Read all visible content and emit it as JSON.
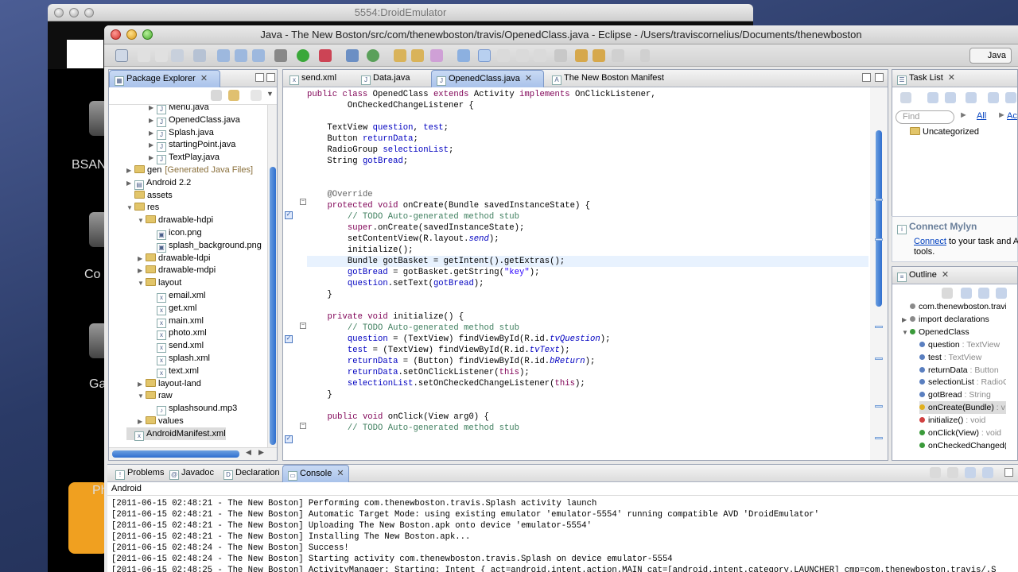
{
  "emulator": {
    "title": "5554:DroidEmulator",
    "labels": [
      "BSAN",
      "Co",
      "Ga",
      "Ph"
    ]
  },
  "eclipse": {
    "title": "Java - The New Boston/src/com/thenewboston/travis/OpenedClass.java - Eclipse - /Users/traviscornelius/Documents/thenewboston",
    "perspective": "Java"
  },
  "package_explorer": {
    "tab_label": "Package Explorer",
    "items": [
      {
        "label": "Menu.java",
        "icon": "java-file-icon",
        "level": 3,
        "top": 0
      },
      {
        "label": "OpenedClass.java",
        "icon": "java-file-icon",
        "level": 3
      },
      {
        "label": "Splash.java",
        "icon": "java-file-icon",
        "level": 3
      },
      {
        "label": "startingPoint.java",
        "icon": "java-file-icon",
        "level": 3
      },
      {
        "label": "TextPlay.java",
        "icon": "java-file-icon",
        "level": 3
      },
      {
        "label": "gen",
        "extra": "[Generated Java Files]",
        "icon": "folder-icon",
        "level": 1
      },
      {
        "label": "Android 2.2",
        "icon": "library-icon",
        "level": 1
      },
      {
        "label": "assets",
        "icon": "folder-icon",
        "level": 1
      },
      {
        "label": "res",
        "icon": "folder-icon",
        "level": 1
      },
      {
        "label": "drawable-hdpi",
        "icon": "folder-icon",
        "level": 2
      },
      {
        "label": "icon.png",
        "icon": "image-file-icon",
        "level": 3
      },
      {
        "label": "splash_background.png",
        "icon": "image-file-icon",
        "level": 3
      },
      {
        "label": "drawable-ldpi",
        "icon": "folder-icon",
        "level": 2
      },
      {
        "label": "drawable-mdpi",
        "icon": "folder-icon",
        "level": 2
      },
      {
        "label": "layout",
        "icon": "folder-icon",
        "level": 2
      },
      {
        "label": "email.xml",
        "icon": "xml-file-icon",
        "level": 3
      },
      {
        "label": "get.xml",
        "icon": "xml-file-icon",
        "level": 3
      },
      {
        "label": "main.xml",
        "icon": "xml-file-icon",
        "level": 3
      },
      {
        "label": "photo.xml",
        "icon": "xml-file-icon",
        "level": 3
      },
      {
        "label": "send.xml",
        "icon": "xml-file-icon",
        "level": 3
      },
      {
        "label": "splash.xml",
        "icon": "xml-file-icon",
        "level": 3
      },
      {
        "label": "text.xml",
        "icon": "xml-file-icon",
        "level": 3
      },
      {
        "label": "layout-land",
        "icon": "folder-icon",
        "level": 2
      },
      {
        "label": "raw",
        "icon": "folder-icon",
        "level": 2
      },
      {
        "label": "splashsound.mp3",
        "icon": "audio-file-icon",
        "level": 3
      },
      {
        "label": "values",
        "icon": "folder-icon",
        "level": 2
      },
      {
        "label": "AndroidManifest.xml",
        "icon": "xml-file-icon",
        "level": 1
      }
    ]
  },
  "editor": {
    "tabs": [
      "send.xml",
      "Data.java",
      "OpenedClass.java",
      "The New Boston Manifest"
    ],
    "active_tab": "OpenedClass.java"
  },
  "task_list": {
    "tab_label": "Task List",
    "find_placeholder": "Find",
    "all_label": "All",
    "acti_label": "Acti",
    "category": "Uncategorized"
  },
  "mylyn": {
    "heading": "Connect Mylyn",
    "link": "Connect",
    "text1": " to your task and A",
    "text2": "tools."
  },
  "outline": {
    "tab_label": "Outline",
    "items": [
      {
        "label": "com.thenewboston.travi",
        "type": ""
      },
      {
        "label": "import declarations",
        "type": ""
      },
      {
        "label": "OpenedClass",
        "type": ""
      },
      {
        "label": "question",
        "type": " : TextView"
      },
      {
        "label": "test",
        "type": " : TextView"
      },
      {
        "label": "returnData",
        "type": " : Button"
      },
      {
        "label": "selectionList",
        "type": " : RadioG"
      },
      {
        "label": "gotBread",
        "type": " : String"
      },
      {
        "label": "onCreate(Bundle)",
        "type": " : v"
      },
      {
        "label": "initialize()",
        "type": " : void"
      },
      {
        "label": "onClick(View)",
        "type": " : void"
      },
      {
        "label": "onCheckedChanged(",
        "type": ""
      }
    ]
  },
  "bottom": {
    "tabs": [
      "Problems",
      "Javadoc",
      "Declaration",
      "Console"
    ],
    "active_tab": "Console",
    "console_name": "Android",
    "lines": [
      "[2011-06-15 02:48:21 - The New Boston] Performing com.thenewboston.travis.Splash activity launch",
      "[2011-06-15 02:48:21 - The New Boston] Automatic Target Mode: using existing emulator 'emulator-5554' running compatible AVD 'DroidEmulator'",
      "[2011-06-15 02:48:21 - The New Boston] Uploading The New Boston.apk onto device 'emulator-5554'",
      "[2011-06-15 02:48:21 - The New Boston] Installing The New Boston.apk...",
      "[2011-06-15 02:48:24 - The New Boston] Success!",
      "[2011-06-15 02:48:24 - The New Boston] Starting activity com.thenewboston.travis.Splash on device emulator-5554",
      "[2011-06-15 02:48:25 - The New Boston] ActivityManager: Starting: Intent { act=android.intent.action.MAIN cat=[android.intent.category.LAUNCHER] cmp=com.thenewboston.travis/.S"
    ]
  }
}
